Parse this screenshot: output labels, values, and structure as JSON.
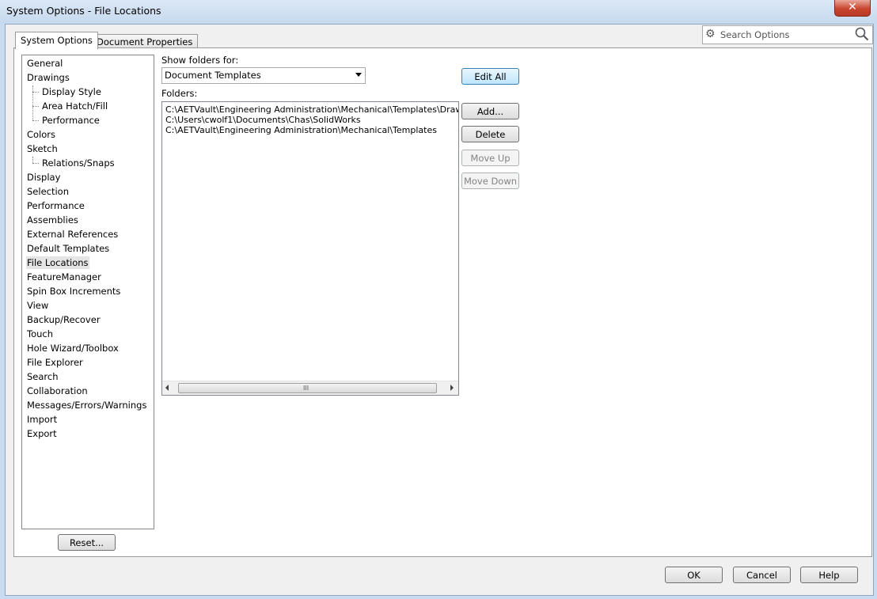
{
  "window": {
    "title": "System Options - File Locations",
    "close_glyph": "✕"
  },
  "tabs": [
    {
      "label": "System Options",
      "active": true
    },
    {
      "label": "Document Properties",
      "active": false
    }
  ],
  "search": {
    "placeholder": "Search Options"
  },
  "nav": {
    "items": [
      {
        "label": "General",
        "indent": 0
      },
      {
        "label": "Drawings",
        "indent": 0
      },
      {
        "label": "Display Style",
        "indent": 1
      },
      {
        "label": "Area Hatch/Fill",
        "indent": 1
      },
      {
        "label": "Performance",
        "indent": 1
      },
      {
        "label": "Colors",
        "indent": 0
      },
      {
        "label": "Sketch",
        "indent": 0
      },
      {
        "label": "Relations/Snaps",
        "indent": 1
      },
      {
        "label": "Display",
        "indent": 0
      },
      {
        "label": "Selection",
        "indent": 0
      },
      {
        "label": "Performance",
        "indent": 0
      },
      {
        "label": "Assemblies",
        "indent": 0
      },
      {
        "label": "External References",
        "indent": 0
      },
      {
        "label": "Default Templates",
        "indent": 0
      },
      {
        "label": "File Locations",
        "indent": 0,
        "selected": true
      },
      {
        "label": "FeatureManager",
        "indent": 0
      },
      {
        "label": "Spin Box Increments",
        "indent": 0
      },
      {
        "label": "View",
        "indent": 0
      },
      {
        "label": "Backup/Recover",
        "indent": 0
      },
      {
        "label": "Touch",
        "indent": 0
      },
      {
        "label": "Hole Wizard/Toolbox",
        "indent": 0
      },
      {
        "label": "File Explorer",
        "indent": 0
      },
      {
        "label": "Search",
        "indent": 0
      },
      {
        "label": "Collaboration",
        "indent": 0
      },
      {
        "label": "Messages/Errors/Warnings",
        "indent": 0
      },
      {
        "label": "Import",
        "indent": 0
      },
      {
        "label": "Export",
        "indent": 0
      }
    ],
    "reset_label": "Reset..."
  },
  "main": {
    "show_folders_label": "Show folders for:",
    "show_folders_value": "Document Templates",
    "folders_label": "Folders:",
    "folders": [
      "C:\\AETVault\\Engineering Administration\\Mechanical\\Templates\\Drawing",
      "C:\\Users\\cwolf1\\Documents\\Chas\\SolidWorks",
      "C:\\AETVault\\Engineering Administration\\Mechanical\\Templates"
    ],
    "scroll_grip": "III",
    "buttons": {
      "edit_all": "Edit All",
      "add": "Add...",
      "delete": "Delete",
      "move_up": "Move Up",
      "move_down": "Move Down"
    }
  },
  "footer": {
    "ok": "OK",
    "cancel": "Cancel",
    "help": "Help"
  },
  "colors": {
    "accent": "#3c7fb1",
    "titlebar": "#c9dcef",
    "close": "#c9452f"
  }
}
